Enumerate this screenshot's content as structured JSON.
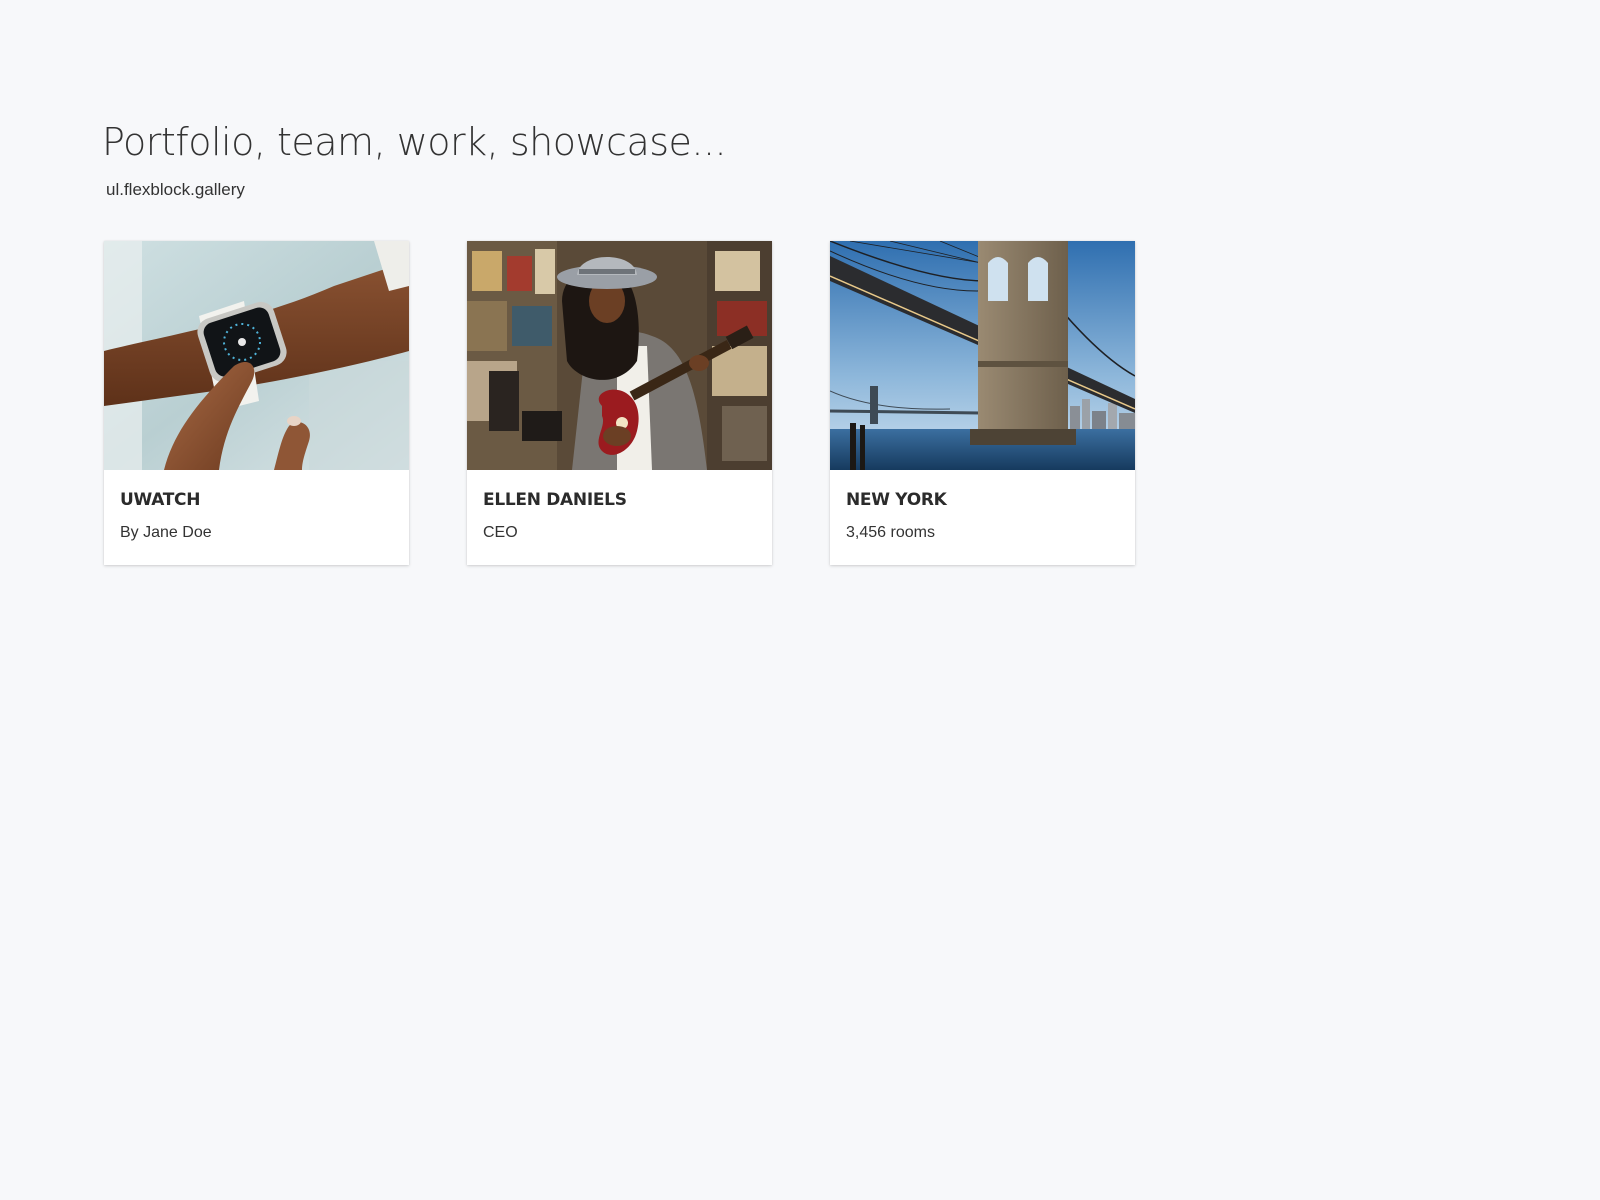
{
  "page": {
    "title": "Portfolio, team, work, showcase...",
    "subtitle": "ul.flexblock.gallery"
  },
  "gallery": {
    "items": [
      {
        "title": "UWATCH",
        "caption": "By Jane Doe",
        "image": "smartwatch-on-wrist-photo"
      },
      {
        "title": "ELLEN DANIELS",
        "caption": "CEO",
        "image": "woman-playing-guitar-photo"
      },
      {
        "title": "NEW YORK",
        "caption": "3,456 rooms",
        "image": "brooklyn-bridge-photo"
      }
    ]
  },
  "colors": {
    "background": "#f7f8fa",
    "card": "#ffffff",
    "text": "#333333"
  }
}
